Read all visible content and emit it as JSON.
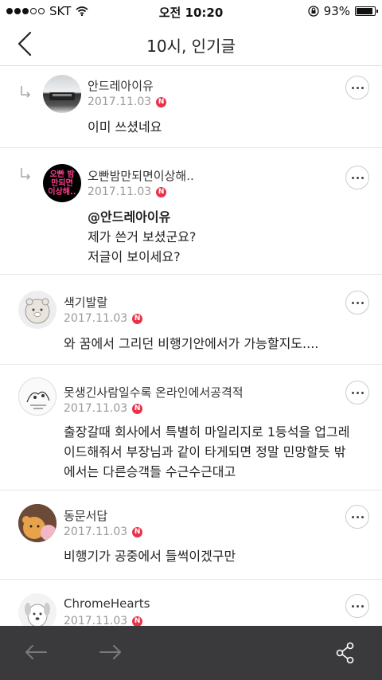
{
  "status_bar": {
    "carrier": "SKT",
    "time": "오전 10:20",
    "battery": "93%",
    "battery_level": 0.93
  },
  "nav": {
    "title": "10시, 인기글"
  },
  "comments": [
    {
      "username": "안드레아이유",
      "date": "2017.11.03",
      "badge": "N",
      "text": "이미 쓰셨네요",
      "reply": true,
      "avatar_icon": "car-photo-avatar"
    },
    {
      "username": "오빤밤만되면이상해..",
      "date": "2017.11.03",
      "badge": "N",
      "mention": "@안드레아이유",
      "text": "제가 쓴거 보셨군요?\n저글이 보이세요?",
      "reply": true,
      "avatar_text": "오빤 밤만되면 이상해..",
      "avatar_icon": "text-avatar"
    },
    {
      "username": "색기발랄",
      "date": "2017.11.03",
      "badge": "N",
      "text": "와 꿈에서 그리던 비행기안에서가 가능할지도....",
      "avatar_icon": "character-avatar"
    },
    {
      "username": "못생긴사람일수록 온라인에서공격적",
      "date": "2017.11.03",
      "badge": "N",
      "text": "출장갈때 회사에서 특별히 마일리지로 1등석을 업그레\n이드해줘서 부장님과 같이 타게되면 정말 민망할듯 밖\n에서는 다른승객들 수근수근대고",
      "avatar_icon": "sketch-avatar"
    },
    {
      "username": "동문서답",
      "date": "2017.11.03",
      "badge": "N",
      "text": "비행기가 공중에서 들썩이겠구만",
      "avatar_icon": "bear-avatar"
    },
    {
      "username": "ChromeHearts",
      "date": "2017.11.03",
      "badge": "N",
      "text": "",
      "avatar_icon": "dog-avatar"
    }
  ],
  "bottom_bar": {
    "back": "arrow-left-icon",
    "forward": "arrow-right-icon",
    "share": "share-icon"
  }
}
